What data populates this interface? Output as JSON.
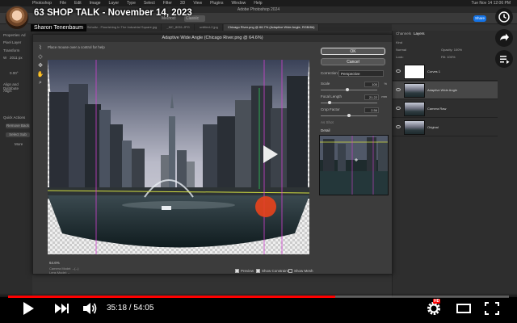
{
  "video": {
    "title": "63 SHOP TALK - November 14, 2023",
    "channel": "Sharon Tenenbaum",
    "current_time": "35:18",
    "duration": "54:05",
    "time_separator": " / ",
    "progress_fraction": 0.653,
    "hd_badge": "HD",
    "accent_color": "#ff0000"
  },
  "photoshop": {
    "app_title": "Adobe Photoshop 2024",
    "menu": [
      "Photoshop",
      "File",
      "Edit",
      "Image",
      "Layer",
      "Type",
      "Select",
      "Filter",
      "3D",
      "View",
      "Plugins",
      "Window",
      "Help"
    ],
    "clock": "Tue Nov 14 12:06 PM",
    "options": {
      "method_label": "Method:",
      "method_value": "Classic",
      "share_label": "Share"
    },
    "doc_tabs": [
      {
        "label": "Lantern Reflections.jpg",
        "active": false
      },
      {
        "label": "John Schultz - Flourishing In The Industrial Square.jpg",
        "active": false
      },
      {
        "label": "_MC_8051.JPG",
        "active": false
      },
      {
        "label": "untitled-2.jpg",
        "active": false
      },
      {
        "label": "Chicago River.png @ 66.7% (Adaptive Wide Angle, RGB/8#)",
        "active": true
      }
    ],
    "left_panel": {
      "tabs": [
        "Properties",
        "Ad"
      ],
      "pixel_layer": "Pixel Layer",
      "transform": "Transform",
      "w": "W",
      "w_val": "2011 px",
      "angle_val": "0.00°",
      "align": "Align and Distribute",
      "align_sub": "Align:",
      "quick_actions": "Quick Actions",
      "remove_bg": "Remove Back",
      "select_subject": "Select Sub",
      "more": "More"
    },
    "dialog": {
      "title": "Adaptive Wide Angle (Chicago River.png @ 64.6%)",
      "hint": "Place mouse over a control for help",
      "ok": "OK",
      "cancel": "Cancel",
      "correction_label": "Correction:",
      "correction_value": "Perspective",
      "scale_label": "Scale",
      "scale_value": "100",
      "scale_unit": "%",
      "scale_fraction": 0.47,
      "focal_label": "Focal Length",
      "focal_value": "21.22",
      "focal_unit": "mm",
      "focal_fraction": 0.15,
      "crop_label": "Crop Factor",
      "crop_value": "2.56",
      "crop_fraction": 0.5,
      "as_shot": "As Shot",
      "detail_label": "Detail",
      "zoom": "64.6%",
      "camera_model": "Camera Model: --(--)",
      "lens_model": "Lens Model: --",
      "preview": "Preview",
      "show_constraints": "Show Constraints",
      "show_mesh": "Show Mesh",
      "tool_icons": [
        "constraint-tool",
        "polygon-constraint-tool",
        "move-tool",
        "hand-tool",
        "zoom-tool"
      ]
    },
    "layers_panel": {
      "tabs": [
        "Channels",
        "Layers"
      ],
      "kind": "Kind",
      "normal": "Normal",
      "opacity": "Opacity: 100%",
      "lock": "Lock:",
      "fill": "Fill: 100%",
      "layers": [
        {
          "name": "Curves 1",
          "thumb": "white",
          "selected": false
        },
        {
          "name": "Adaptive Wide Angle",
          "thumb": "photo",
          "selected": true
        },
        {
          "name": "Camera Raw",
          "thumb": "photo",
          "selected": false
        },
        {
          "name": "Original",
          "thumb": "photo",
          "selected": false
        }
      ]
    }
  },
  "controls": {
    "play": "play-icon",
    "next": "next-icon",
    "volume": "volume-icon",
    "settings": "gear-icon",
    "theater": "theater-icon",
    "fullscreen": "fullscreen-icon",
    "side_actions": [
      "clock-icon",
      "share-icon",
      "playlist-icon"
    ]
  }
}
